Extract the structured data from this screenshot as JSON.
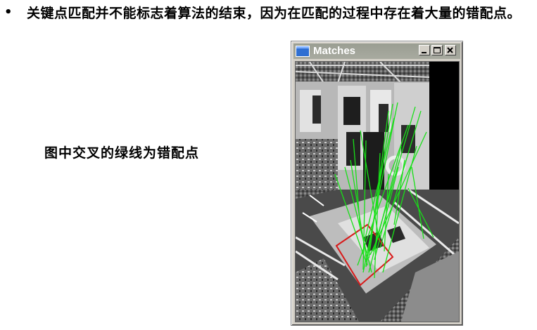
{
  "slide": {
    "bullet": "•",
    "text": "关键点匹配并不能标志着算法的结束，因为在匹配的过程中存在着大量的错配点。",
    "caption": "图中交叉的绿线为错配点"
  },
  "window": {
    "title": "Matches",
    "buttons": [
      "minimize",
      "maximize",
      "close"
    ]
  },
  "colors": {
    "match_line": "#18e018",
    "homography_box": "#d81a1a",
    "titlebar": "#9a9e92"
  }
}
